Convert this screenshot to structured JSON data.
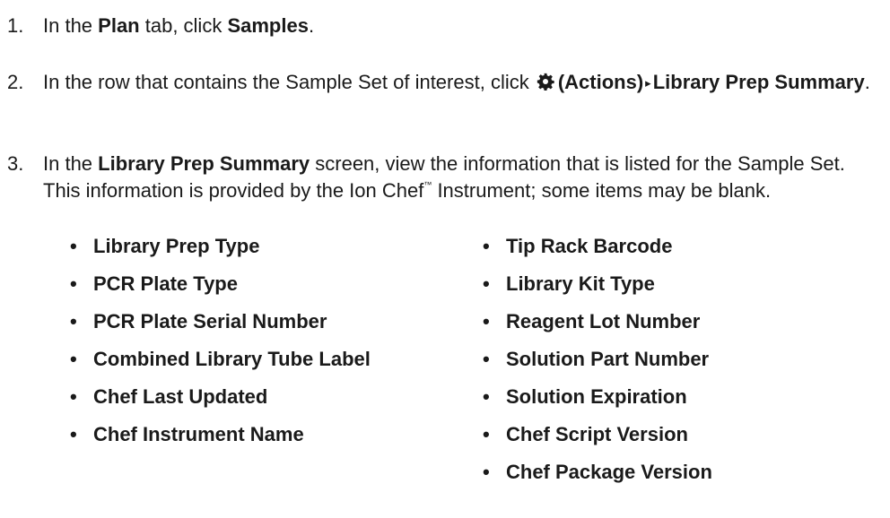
{
  "steps": [
    {
      "number": "1.",
      "parts": {
        "a": "In the ",
        "b": "Plan",
        "c": " tab, click ",
        "d": "Samples",
        "e": "."
      }
    },
    {
      "number": "2.",
      "parts": {
        "a": "In the row that contains the Sample Set of interest, click ",
        "icon": "gear-icon",
        "b": "(Actions)",
        "arrow": "▸",
        "c": "Library Prep Summary",
        "d": "."
      }
    },
    {
      "number": "3.",
      "parts": {
        "a": "In the ",
        "b": "Library Prep Summary",
        "c": " screen, view the information that is listed for the Sample Set. This information is provided by the Ion Chef",
        "tm": "™",
        "d": " Instrument; some items may be blank."
      }
    }
  ],
  "bullet_glyph": "•",
  "fields_left": [
    "Library Prep Type",
    "PCR Plate Type",
    "PCR Plate Serial Number",
    "Combined Library Tube Label",
    "Chef Last Updated",
    "Chef Instrument Name"
  ],
  "fields_right": [
    "Tip Rack Barcode",
    "Library Kit Type",
    "Reagent Lot Number",
    "Solution Part Number",
    "Solution Expiration",
    "Chef Script Version",
    "Chef Package Version"
  ],
  "colors": {
    "text": "#1a1a1a",
    "icon": "#1a1a1a"
  }
}
